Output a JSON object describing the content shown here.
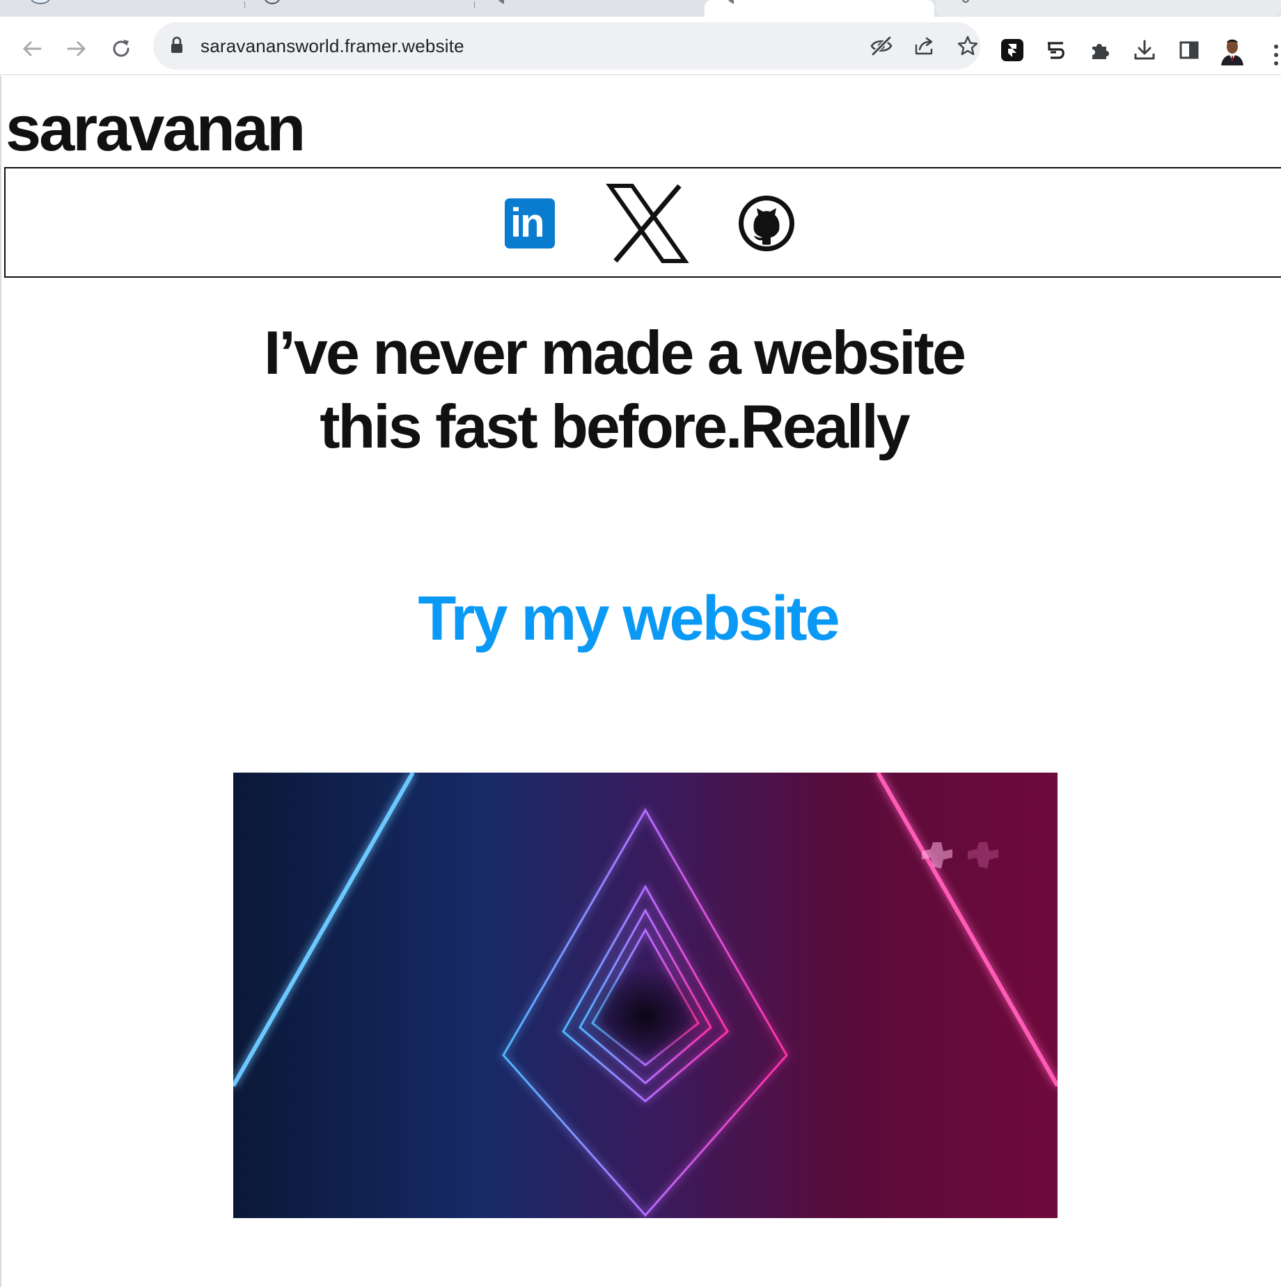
{
  "browser": {
    "url": "saravanansworld.framer.website",
    "profile_icon": "profile-avatar",
    "toolbar_icons": [
      "back-arrow-icon",
      "forward-arrow-icon",
      "reload-icon",
      "lock-icon",
      "eye-slash-icon",
      "share-icon",
      "star-icon",
      "framer-extension-icon",
      "extension-icon",
      "puzzle-icon",
      "download-icon",
      "side-panel-icon",
      "more-icon"
    ]
  },
  "page": {
    "brand": "saravanan",
    "social_links": [
      {
        "name": "linkedin",
        "icon": "linkedin-icon",
        "label": "in",
        "color": "#0a7ccf"
      },
      {
        "name": "x",
        "icon": "x-icon"
      },
      {
        "name": "github",
        "icon": "github-icon"
      }
    ],
    "headline_line1": "I’ve never made a website",
    "headline_line2": "this fast before.Really",
    "cta": "Try my website",
    "cta_color": "#0a99f5",
    "hero_image": "neon-triangle-tunnel"
  }
}
